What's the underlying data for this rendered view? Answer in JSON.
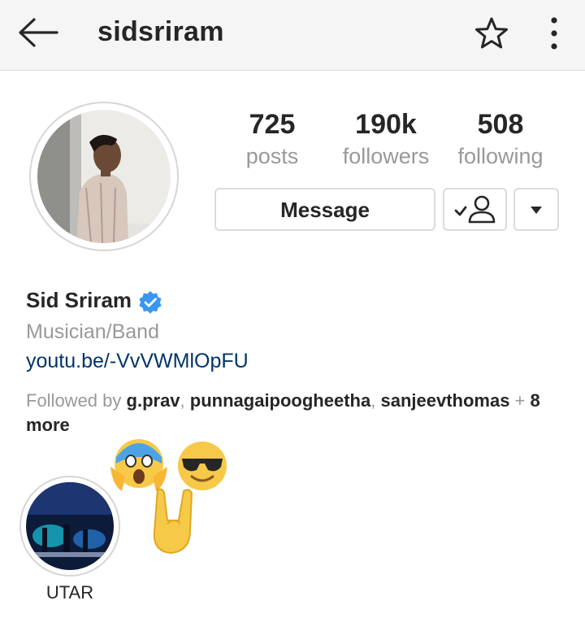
{
  "header": {
    "username": "sidsriram",
    "back_icon": "arrow-left-icon",
    "star_icon": "star-outline-icon",
    "more_icon": "vertical-dots-icon"
  },
  "stats": [
    {
      "value": "725",
      "label": "posts"
    },
    {
      "value": "190k",
      "label": "followers"
    },
    {
      "value": "508",
      "label": "following"
    }
  ],
  "actions": {
    "message_label": "Message",
    "following_icon": "person-check-icon",
    "dropdown_icon": "caret-down-icon"
  },
  "bio": {
    "name": "Sid Sriram",
    "category": "Musician/Band",
    "link": "youtu.be/-VvVWMlOpFU",
    "followed_by_prefix": "Followed by ",
    "followers_mutual": [
      "g.prav",
      "punnagaipoogheetha",
      "sanjeevthomas"
    ],
    "sep": ", ",
    "plus": " + ",
    "more": "8 more"
  },
  "highlights": [
    {
      "label": "UTAR"
    }
  ],
  "colors": {
    "link": "#003569",
    "verified": "#3897f0",
    "muted": "#999999"
  }
}
